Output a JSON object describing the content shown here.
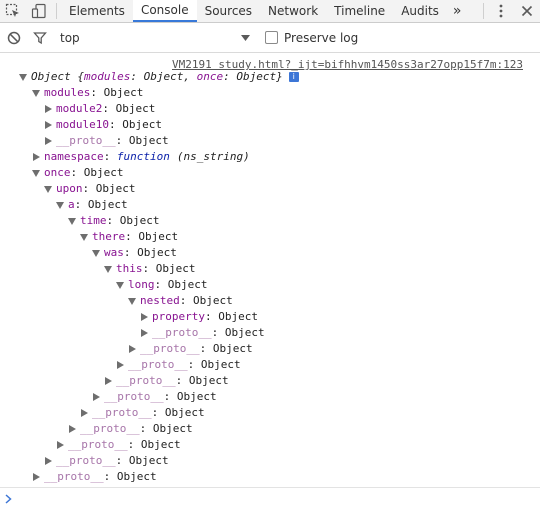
{
  "tabs": [
    {
      "label": "Elements",
      "active": false
    },
    {
      "label": "Console",
      "active": true
    },
    {
      "label": "Sources",
      "active": false
    },
    {
      "label": "Network",
      "active": false
    },
    {
      "label": "Timeline",
      "active": false
    },
    {
      "label": "Audits",
      "active": false
    }
  ],
  "toolbar": {
    "more_tabs": "»",
    "context": "top",
    "preserve_log": "Preserve log"
  },
  "console": {
    "source_link": "VM2191 study.html?_ijt=bifhhvm1450ss3ar27opp15f7m:123",
    "summary": {
      "prefix": "Object {",
      "modules": "modules",
      "modules_val": "Object",
      "once": "once",
      "once_val": "Object",
      "suffix": "}",
      "info": "i"
    },
    "lines": [
      {
        "key": "modules",
        "value": "Object",
        "depth": 1,
        "expanded": true
      },
      {
        "key": "module2",
        "value": "Object",
        "depth": 2,
        "expanded": false
      },
      {
        "key": "module10",
        "value": "Object",
        "depth": 2,
        "expanded": false
      },
      {
        "key": "__proto__",
        "value": "Object",
        "depth": 2,
        "expanded": false
      },
      {
        "key": "namespace",
        "value": "function",
        "extra": "(ns_string)",
        "depth": 1,
        "expanded": false
      },
      {
        "key": "once",
        "value": "Object",
        "depth": 1,
        "expanded": true
      },
      {
        "key": "upon",
        "value": "Object",
        "depth": 2,
        "expanded": true
      },
      {
        "key": "a",
        "value": "Object",
        "depth": 3,
        "expanded": true
      },
      {
        "key": "time",
        "value": "Object",
        "depth": 4,
        "expanded": true
      },
      {
        "key": "there",
        "value": "Object",
        "depth": 5,
        "expanded": true
      },
      {
        "key": "was",
        "value": "Object",
        "depth": 6,
        "expanded": true
      },
      {
        "key": "this",
        "value": "Object",
        "depth": 7,
        "expanded": true
      },
      {
        "key": "long",
        "value": "Object",
        "depth": 8,
        "expanded": true
      },
      {
        "key": "nested",
        "value": "Object",
        "depth": 9,
        "expanded": true
      },
      {
        "key": "property",
        "value": "Object",
        "depth": 10,
        "expanded": false
      },
      {
        "key": "__proto__",
        "value": "Object",
        "depth": 10,
        "expanded": false
      },
      {
        "key": "__proto__",
        "value": "Object",
        "depth": 9,
        "expanded": false
      },
      {
        "key": "__proto__",
        "value": "Object",
        "depth": 8,
        "expanded": false
      },
      {
        "key": "__proto__",
        "value": "Object",
        "depth": 7,
        "expanded": false
      },
      {
        "key": "__proto__",
        "value": "Object",
        "depth": 6,
        "expanded": false
      },
      {
        "key": "__proto__",
        "value": "Object",
        "depth": 5,
        "expanded": false
      },
      {
        "key": "__proto__",
        "value": "Object",
        "depth": 4,
        "expanded": false
      },
      {
        "key": "__proto__",
        "value": "Object",
        "depth": 3,
        "expanded": false
      },
      {
        "key": "__proto__",
        "value": "Object",
        "depth": 2,
        "expanded": false
      },
      {
        "key": "__proto__",
        "value": "Object",
        "depth": 1,
        "expanded": false
      }
    ]
  },
  "colors": {
    "key": "#881391",
    "proto_key": "#a775a9",
    "active_tab_underline": "#3879d9",
    "prompt": "#3d76d6"
  }
}
